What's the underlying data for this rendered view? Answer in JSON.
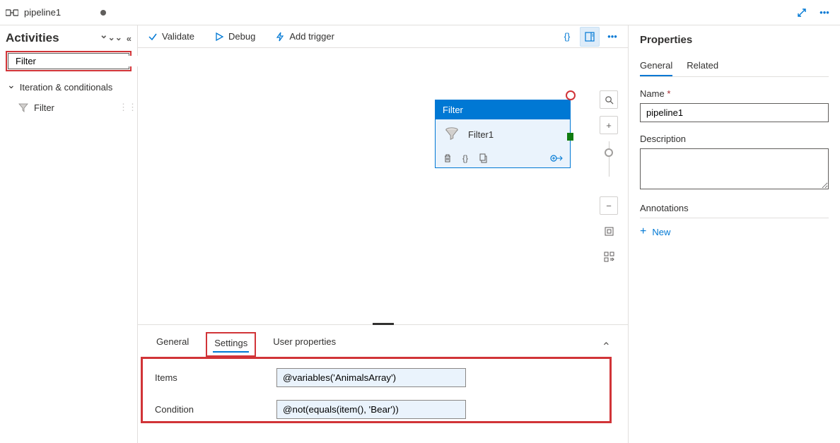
{
  "topbar": {
    "pipeline_name": "pipeline1"
  },
  "toolbar": {
    "validate": "Validate",
    "debug": "Debug",
    "add_trigger": "Add trigger"
  },
  "sidebar": {
    "title": "Activities",
    "search_value": "Filter",
    "section": "Iteration & conditionals",
    "items": [
      {
        "label": "Filter"
      }
    ]
  },
  "canvas": {
    "node_type": "Filter",
    "node_name": "Filter1"
  },
  "bottom_panel": {
    "tabs": {
      "general": "General",
      "settings": "Settings",
      "user_properties": "User properties"
    },
    "active": "Settings",
    "fields": {
      "items_label": "Items",
      "items_value": "@variables('AnimalsArray')",
      "condition_label": "Condition",
      "condition_value": "@not(equals(item(), 'Bear'))"
    }
  },
  "properties": {
    "title": "Properties",
    "tabs": {
      "general": "General",
      "related": "Related"
    },
    "name_label": "Name",
    "name_value": "pipeline1",
    "description_label": "Description",
    "description_value": "",
    "annotations_label": "Annotations",
    "new_label": "New"
  }
}
